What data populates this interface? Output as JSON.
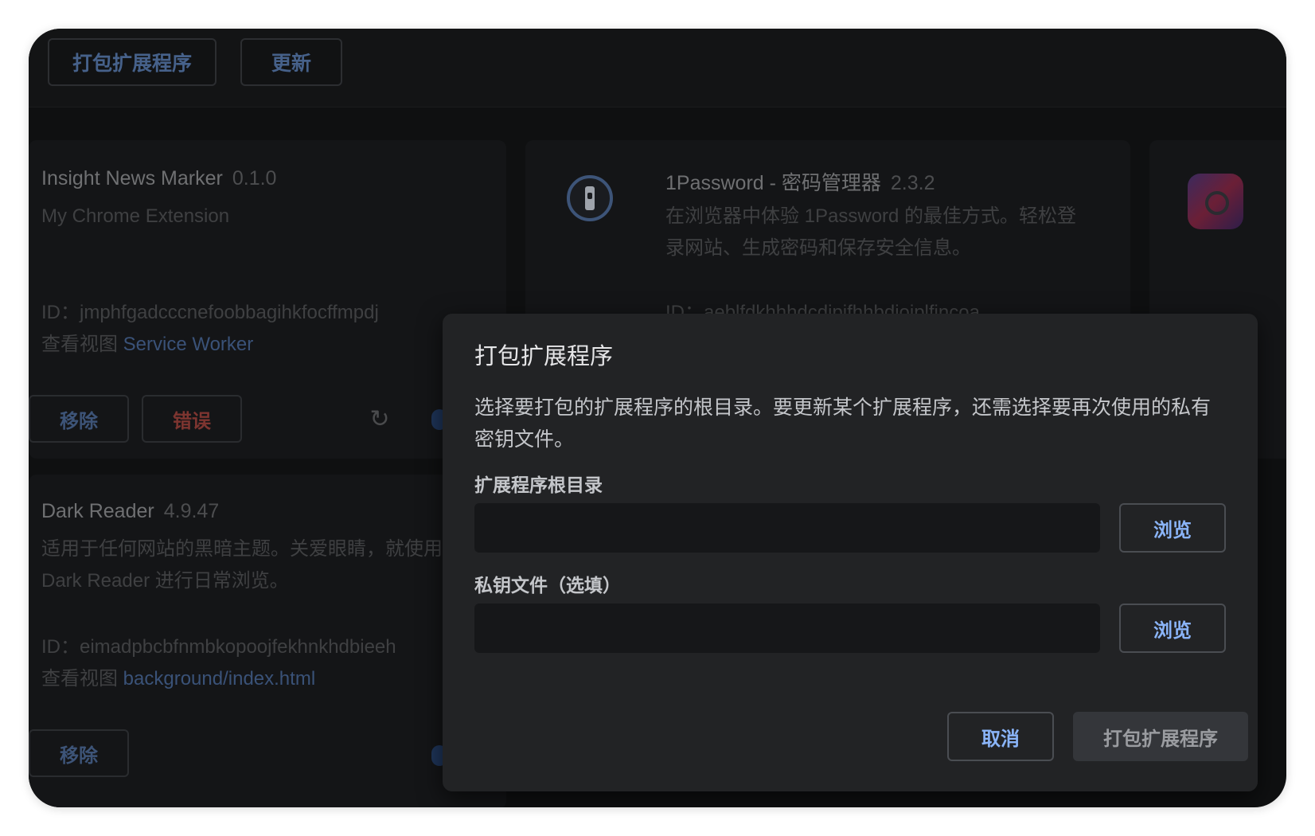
{
  "toolbar": {
    "pack_button": "打包扩展程序",
    "update_button": "更新"
  },
  "extensions": [
    {
      "name": "Insight News Marker",
      "version": "0.1.0",
      "description": "My Chrome Extension",
      "id_label": "ID：",
      "id": "jmphfgadcccnefoobbagihkfocffmpdj",
      "view_label": "查看视图",
      "view_link": "Service Worker",
      "remove_button": "移除",
      "error_button": "错误"
    },
    {
      "name": "1Password - 密码管理器",
      "version": "2.3.2",
      "description_line1": "在浏览器中体验 1Password 的最佳方式。轻松登",
      "description_line2": "录网站、生成密码和保存安全信息。",
      "id_label": "ID：",
      "id": "aeblfdkhhhdcdjpifhhbdiojplfjncoa"
    },
    {
      "name": "Dark Reader",
      "version": "4.9.47",
      "description_line1": "适用于任何网站的黑暗主题。关爱眼睛，就使用",
      "description_line2": "Dark Reader 进行日常浏览。",
      "id_label": "ID：",
      "id": "eimadpbcbfnmbkopoojfekhnkhdbieeh",
      "view_label": "查看视图",
      "view_link": "background/index.html",
      "remove_button": "移除"
    }
  ],
  "dialog": {
    "title": "打包扩展程序",
    "description": "选择要打包的扩展程序的根目录。要更新某个扩展程序，还需选择要再次使用的私有密钥文件。",
    "root_label": "扩展程序根目录",
    "root_value": "",
    "key_label": "私钥文件（选填）",
    "key_value": "",
    "browse_label": "浏览",
    "cancel_button": "取消",
    "pack_button": "打包扩展程序"
  },
  "colors": {
    "accent": "#8ab4f8",
    "error": "#8a3a34",
    "dialog_bg": "#222325"
  }
}
